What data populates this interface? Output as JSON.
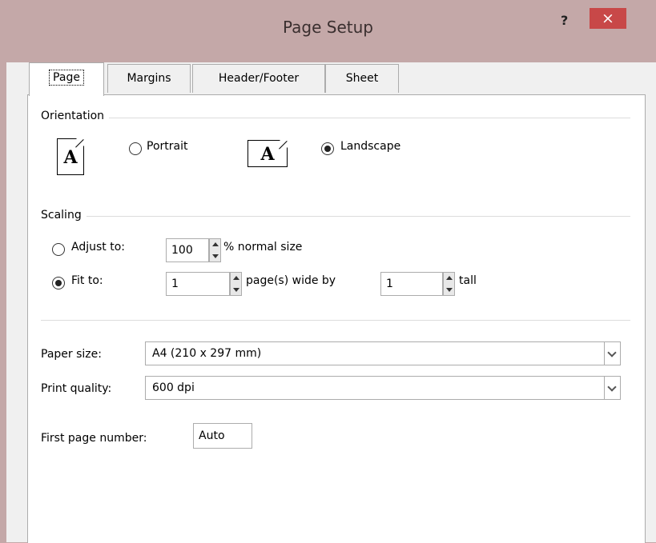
{
  "window": {
    "title": "Page Setup",
    "help_label": "?",
    "close_label": "×"
  },
  "tabs": [
    {
      "label": "Page",
      "active": true
    },
    {
      "label": "Margins"
    },
    {
      "label": "Header/Footer"
    },
    {
      "label": "Sheet"
    }
  ],
  "orientation": {
    "group_label": "Orientation",
    "icon_letter": "A",
    "portrait_label": "Portrait",
    "landscape_label": "Landscape",
    "selected": "Landscape"
  },
  "scaling": {
    "group_label": "Scaling",
    "adjust_to_label": "Adjust to:",
    "adjust_value": "100",
    "normal_size_label": "% normal size",
    "fit_to_label": "Fit to:",
    "fit_wide_value": "1",
    "wide_by_label": "page(s) wide by",
    "fit_tall_value": "1",
    "tall_label": "tall",
    "selected": "Fit to:"
  },
  "paper_size": {
    "label": "Paper size:",
    "value": "A4 (210 x 297 mm)"
  },
  "print_quality": {
    "label": "Print quality:",
    "value": "600 dpi"
  },
  "first_page_number": {
    "label": "First page number:",
    "value": "Auto"
  },
  "colors": {
    "title_bar": "#c4a8a8",
    "close_button": "#c84848",
    "panel": "#ffffff"
  }
}
